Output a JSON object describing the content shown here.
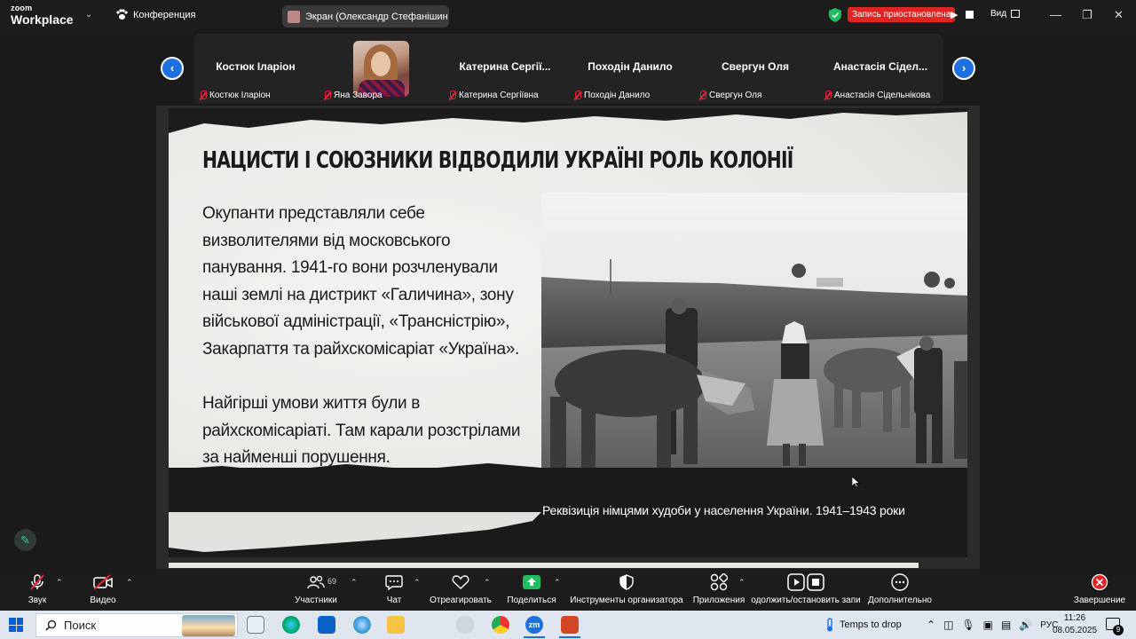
{
  "app": {
    "logo_line1": "zoom",
    "logo_line2": "Workplace",
    "conference_label": "Конференция",
    "screen_share_label": "Экран (Олександр Стефанішин",
    "recording_status": "Запись приостановлена",
    "view_label": "Вид"
  },
  "participants": [
    {
      "name": "Костюк Іларіон",
      "label": "Костюк Іларіон",
      "has_photo": false
    },
    {
      "name": "",
      "label": "Яна Завора",
      "has_photo": true
    },
    {
      "name": "Катерина  Сергії...",
      "label": "Катерина Сергіївна",
      "has_photo": false
    },
    {
      "name": "Походін Данило",
      "label": "Походін Данило",
      "has_photo": false
    },
    {
      "name": "Свергун Оля",
      "label": "Свергун Оля",
      "has_photo": false
    },
    {
      "name": "Анастасія Сідел...",
      "label": "Анастасія Сідельнікова",
      "has_photo": false
    }
  ],
  "slide": {
    "title": "НАЦИСТИ І СОЮЗНИКИ ВІДВОДИЛИ УКРАЇНІ РОЛЬ КОЛОНІЇ",
    "paragraph1": "Окупанти представляли себе визволителями від московського панування. 1941-го вони розчленували наші землі на дистрикт «Галичина», зону військової адміністрації, «Трансністрію», Закарпаття та райхскомісаріат «Україна».",
    "paragraph2": "Найгірші умови життя були в райхскомісаріаті. Там карали розстрілами за найменші порушення.",
    "caption": "Реквізиція німцями худоби у населення України. 1941–1943 роки"
  },
  "toolbar": {
    "audio": "Звук",
    "video": "Видео",
    "participants": "Участники",
    "participants_count": "69",
    "chat": "Чат",
    "react": "Отреагировать",
    "share": "Поделиться",
    "host_tools": "Инструменты организатора",
    "apps": "Приложения",
    "recording": "одолжить/остановить запи",
    "more": "Дополнительно",
    "end": "Завершение"
  },
  "taskbar": {
    "search_placeholder": "Поиск",
    "weather_text": "Temps to drop",
    "language": "РУС",
    "time": "11:26",
    "date": "08.05.2025",
    "notifications": "9"
  },
  "colors": {
    "accent_blue": "#1e6fe0",
    "recording_red": "#e02424",
    "share_green": "#1fbf5f",
    "end_red": "#e02424"
  }
}
